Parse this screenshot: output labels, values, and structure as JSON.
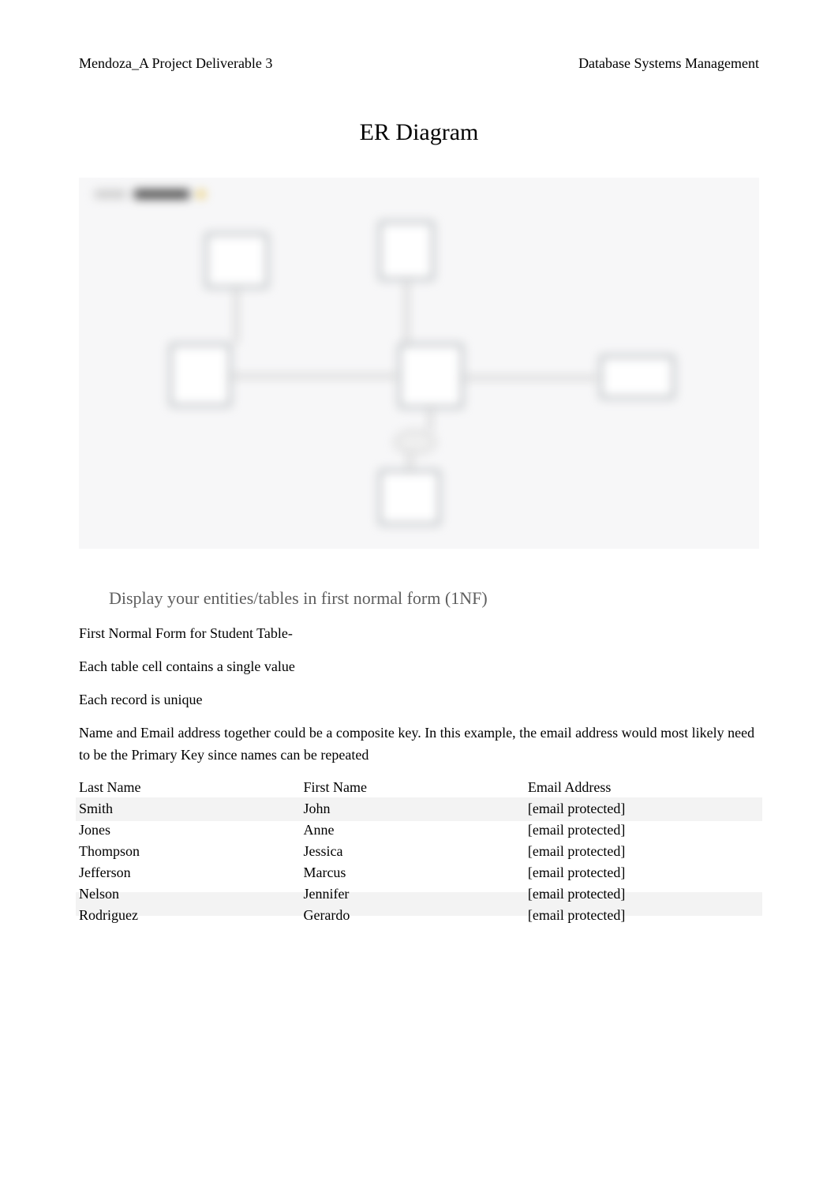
{
  "header": {
    "left": "Mendoza_A Project Deliverable 3",
    "right": "Database Systems Management"
  },
  "title": "ER Diagram",
  "section": {
    "bullet_glyph": "",
    "heading": "Display your entities/tables in first normal form (1NF)"
  },
  "paragraphs": {
    "p1": "First Normal Form for Student Table-",
    "p2": "Each table cell contains a single value",
    "p3": "Each record is unique",
    "p4": "Name and Email address together could be a composite key. In this example, the email address would most likely need to be the Primary Key since names can be repeated"
  },
  "table": {
    "headers": {
      "last": "Last Name",
      "first": "First Name",
      "email": "Email Address"
    },
    "rows": [
      {
        "last": "Smith",
        "first": "John",
        "email": "[email protected]"
      },
      {
        "last": "Jones",
        "first": "Anne",
        "email": "[email protected]"
      },
      {
        "last": "Thompson",
        "first": "Jessica",
        "email": "[email protected]"
      },
      {
        "last": "Jefferson",
        "first": "Marcus",
        "email": "[email protected]"
      },
      {
        "last": "Nelson",
        "first": "Jennifer",
        "email": "[email protected]"
      },
      {
        "last": "Rodriguez",
        "first": "Gerardo",
        "email": "[email protected]"
      }
    ]
  }
}
